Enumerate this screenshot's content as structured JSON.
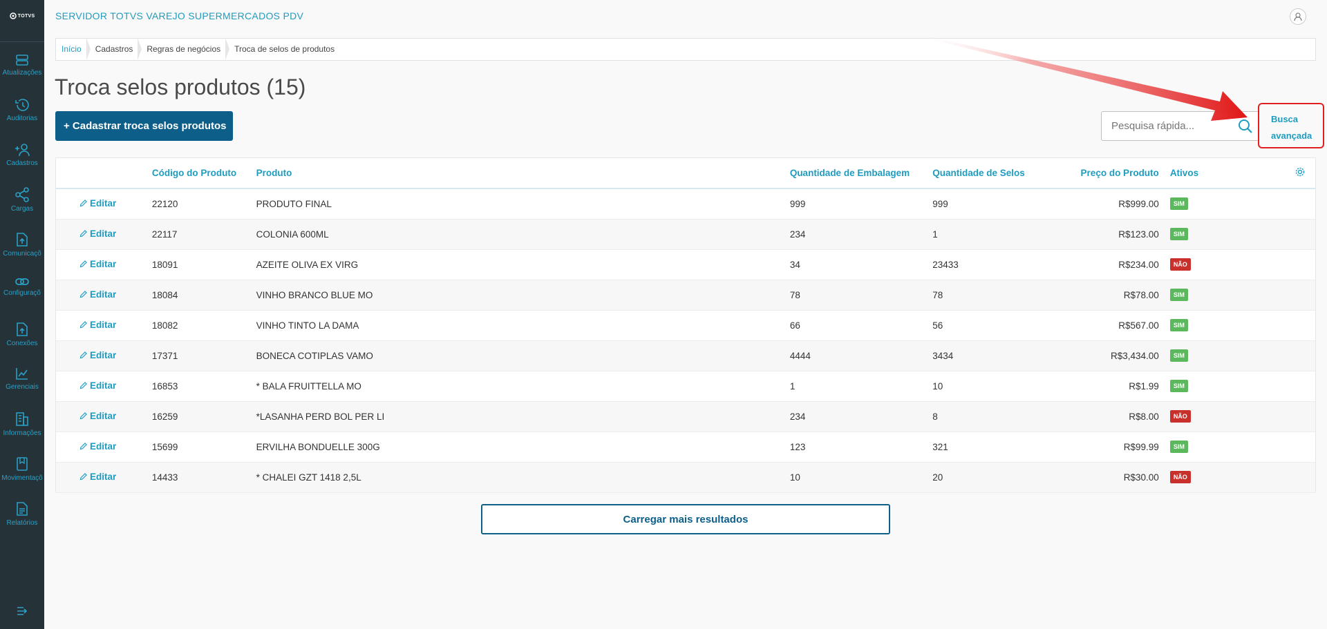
{
  "app": {
    "title": "SERVIDOR TOTVS VAREJO SUPERMERCADOS PDV",
    "logo_text": "TOTVS"
  },
  "sidebar": {
    "items": [
      {
        "label": "Atualizações",
        "icon": "server-icon"
      },
      {
        "label": "Auditorias",
        "icon": "history-icon"
      },
      {
        "label": "Cadastros",
        "icon": "user-add-icon"
      },
      {
        "label": "Cargas",
        "icon": "share-icon"
      },
      {
        "label": "Comunicaçõ",
        "icon": "upload-file-icon"
      },
      {
        "label": "Configuraçõ",
        "icon": "link-icon"
      },
      {
        "label": "Conexões",
        "icon": "upload-icon"
      },
      {
        "label": "Gerenciais",
        "icon": "chart-icon"
      },
      {
        "label": "Informações",
        "icon": "building-icon"
      },
      {
        "label": "Movimentaçõ",
        "icon": "bookmark-icon"
      },
      {
        "label": "Relatórios",
        "icon": "document-icon"
      }
    ]
  },
  "breadcrumb": [
    "Início",
    "Cadastros",
    "Regras de negócios",
    "Troca de selos de produtos"
  ],
  "page": {
    "title": "Troca selos produtos (15)",
    "add_button": "+  Cadastrar troca selos produtos",
    "search_placeholder": "Pesquisa rápida...",
    "advanced_search": "Busca avançada"
  },
  "table": {
    "columns": [
      "Código do Produto",
      "Produto",
      "Quantidade de Embalagem",
      "Quantidade de Selos",
      "Preço do Produto",
      "Ativos"
    ],
    "edit_label": "Editar",
    "rows": [
      {
        "code": "22120",
        "product": "PRODUTO FINAL",
        "qty_pack": "999",
        "qty_seals": "999",
        "price": "R$999.00",
        "active": "SIM"
      },
      {
        "code": "22117",
        "product": "COLONIA 600ML",
        "qty_pack": "234",
        "qty_seals": "1",
        "price": "R$123.00",
        "active": "SIM"
      },
      {
        "code": "18091",
        "product": "AZEITE OLIVA EX VIRG",
        "qty_pack": "34",
        "qty_seals": "23433",
        "price": "R$234.00",
        "active": "NÃO"
      },
      {
        "code": "18084",
        "product": "VINHO BRANCO BLUE MO",
        "qty_pack": "78",
        "qty_seals": "78",
        "price": "R$78.00",
        "active": "SIM"
      },
      {
        "code": "18082",
        "product": "VINHO TINTO LA DAMA",
        "qty_pack": "66",
        "qty_seals": "56",
        "price": "R$567.00",
        "active": "SIM"
      },
      {
        "code": "17371",
        "product": "BONECA COTIPLAS VAMO",
        "qty_pack": "4444",
        "qty_seals": "3434",
        "price": "R$3,434.00",
        "active": "SIM"
      },
      {
        "code": "16853",
        "product": "* BALA FRUITTELLA MO",
        "qty_pack": "1",
        "qty_seals": "10",
        "price": "R$1.99",
        "active": "SIM"
      },
      {
        "code": "16259",
        "product": "*LASANHA PERD BOL PER LI",
        "qty_pack": "234",
        "qty_seals": "8",
        "price": "R$8.00",
        "active": "NÃO"
      },
      {
        "code": "15699",
        "product": "ERVILHA BONDUELLE 300G",
        "qty_pack": "123",
        "qty_seals": "321",
        "price": "R$99.99",
        "active": "SIM"
      },
      {
        "code": "14433",
        "product": "* CHALEI GZT 1418 2,5L",
        "qty_pack": "10",
        "qty_seals": "20",
        "price": "R$30.00",
        "active": "NÃO"
      }
    ]
  },
  "load_more": "Carregar mais resultados",
  "colors": {
    "sidebar_bg": "#253238",
    "accent": "#1e9cc0",
    "primary_button": "#0d5e89",
    "badge_yes": "#5cb85c",
    "badge_no": "#c9302c",
    "annotation_red": "#e02020"
  }
}
